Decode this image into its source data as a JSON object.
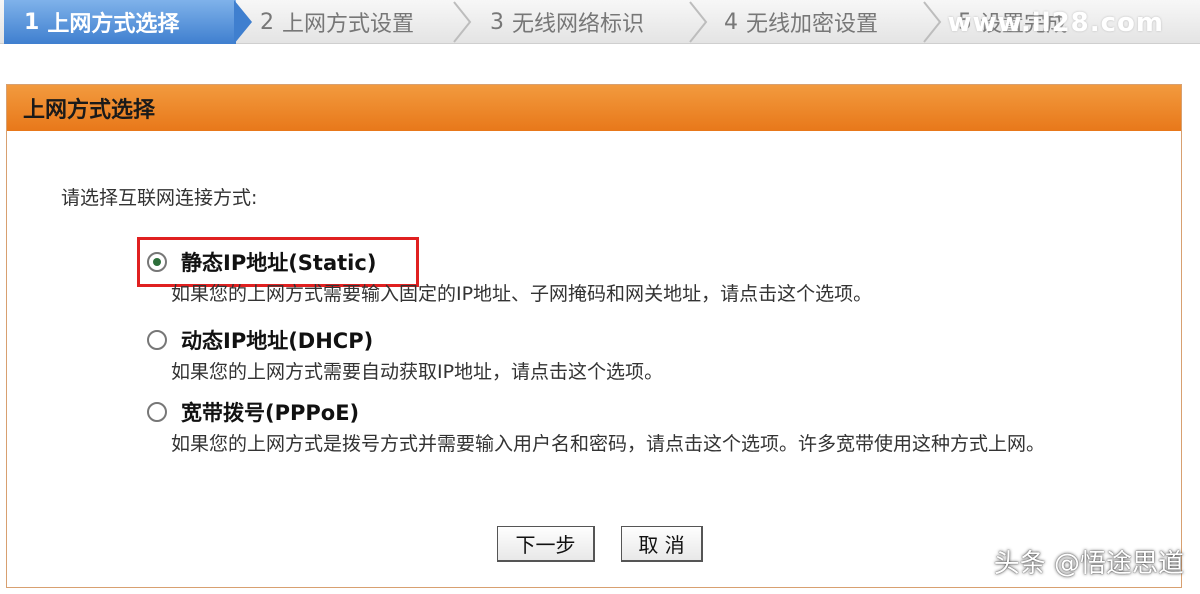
{
  "wizard": {
    "steps": [
      {
        "num": "1",
        "label": "上网方式选择"
      },
      {
        "num": "2",
        "label": "上网方式设置"
      },
      {
        "num": "3",
        "label": "无线网络标识"
      },
      {
        "num": "4",
        "label": "无线加密设置"
      },
      {
        "num": "5",
        "label": "设置完成"
      }
    ],
    "watermark": "www.il28.com"
  },
  "panel": {
    "title": "上网方式选择",
    "prompt": "请选择互联网连接方式:",
    "options": [
      {
        "label": "静态IP地址(Static)",
        "desc": "如果您的上网方式需要输入固定的IP地址、子网掩码和网关地址，请点击这个选项。",
        "selected": true
      },
      {
        "label": "动态IP地址(DHCP)",
        "desc": "如果您的上网方式需要自动获取IP地址，请点击这个选项。",
        "selected": false
      },
      {
        "label": "宽带拨号(PPPoE)",
        "desc": "如果您的上网方式是拨号方式并需要输入用户名和密码，请点击这个选项。许多宽带使用这种方式上网。",
        "selected": false
      }
    ],
    "buttons": {
      "next": "下一步",
      "cancel": "取 消"
    }
  },
  "credit": "头条 @悟途思道",
  "colors": {
    "header_orange": "#e8781a",
    "step_active_blue": "#3f7fcf",
    "highlight_red": "#e02020"
  }
}
